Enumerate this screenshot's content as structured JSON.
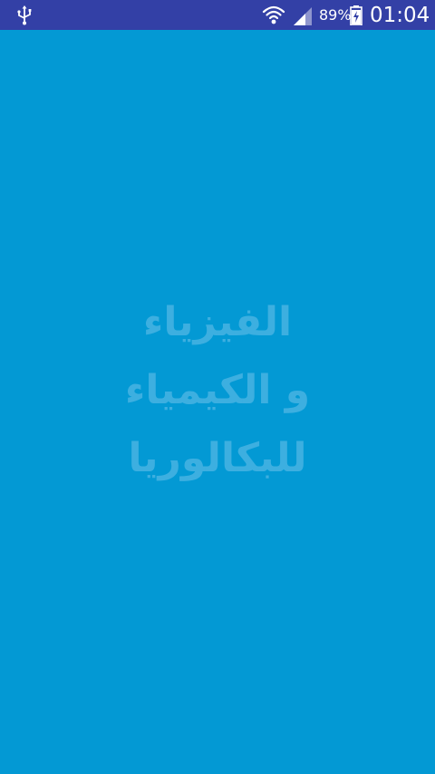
{
  "status_bar": {
    "icons": [
      "usb-icon",
      "wifi-icon",
      "signal-icon",
      "battery-charging-icon"
    ],
    "battery_percent": "89%",
    "time": "01:04"
  },
  "splash": {
    "title_line1": "الفيزياء",
    "title_line2": "و الكيمياء",
    "title_line3": "للبكالوريا"
  },
  "colors": {
    "status_bar_bg": "#3340a6",
    "screen_bg": "#0399d4",
    "title_text": "#3dafe0"
  }
}
